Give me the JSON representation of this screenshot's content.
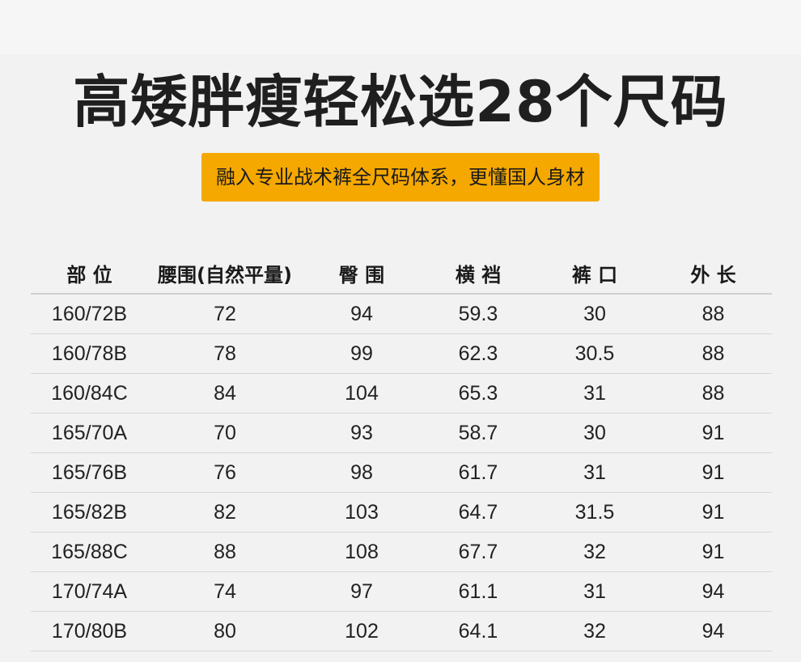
{
  "header": {
    "title": "高矮胖瘦轻松选28个尺码",
    "subtitle": "融入专业战术裤全尺码体系，更懂国人身材",
    "accent_color": "#f5a800"
  },
  "table": {
    "columns": [
      "部 位",
      "腰围(自然平量)",
      "臀 围",
      "横 裆",
      "裤 口",
      "外 长"
    ],
    "rows": [
      [
        "160/72B",
        "72",
        "94",
        "59.3",
        "30",
        "88"
      ],
      [
        "160/78B",
        "78",
        "99",
        "62.3",
        "30.5",
        "88"
      ],
      [
        "160/84C",
        "84",
        "104",
        "65.3",
        "31",
        "88"
      ],
      [
        "165/70A",
        "70",
        "93",
        "58.7",
        "30",
        "91"
      ],
      [
        "165/76B",
        "76",
        "98",
        "61.7",
        "31",
        "91"
      ],
      [
        "165/82B",
        "82",
        "103",
        "64.7",
        "31.5",
        "91"
      ],
      [
        "165/88C",
        "88",
        "108",
        "67.7",
        "32",
        "91"
      ],
      [
        "170/74A",
        "74",
        "97",
        "61.1",
        "31",
        "94"
      ],
      [
        "170/80B",
        "80",
        "102",
        "64.1",
        "32",
        "94"
      ]
    ]
  }
}
